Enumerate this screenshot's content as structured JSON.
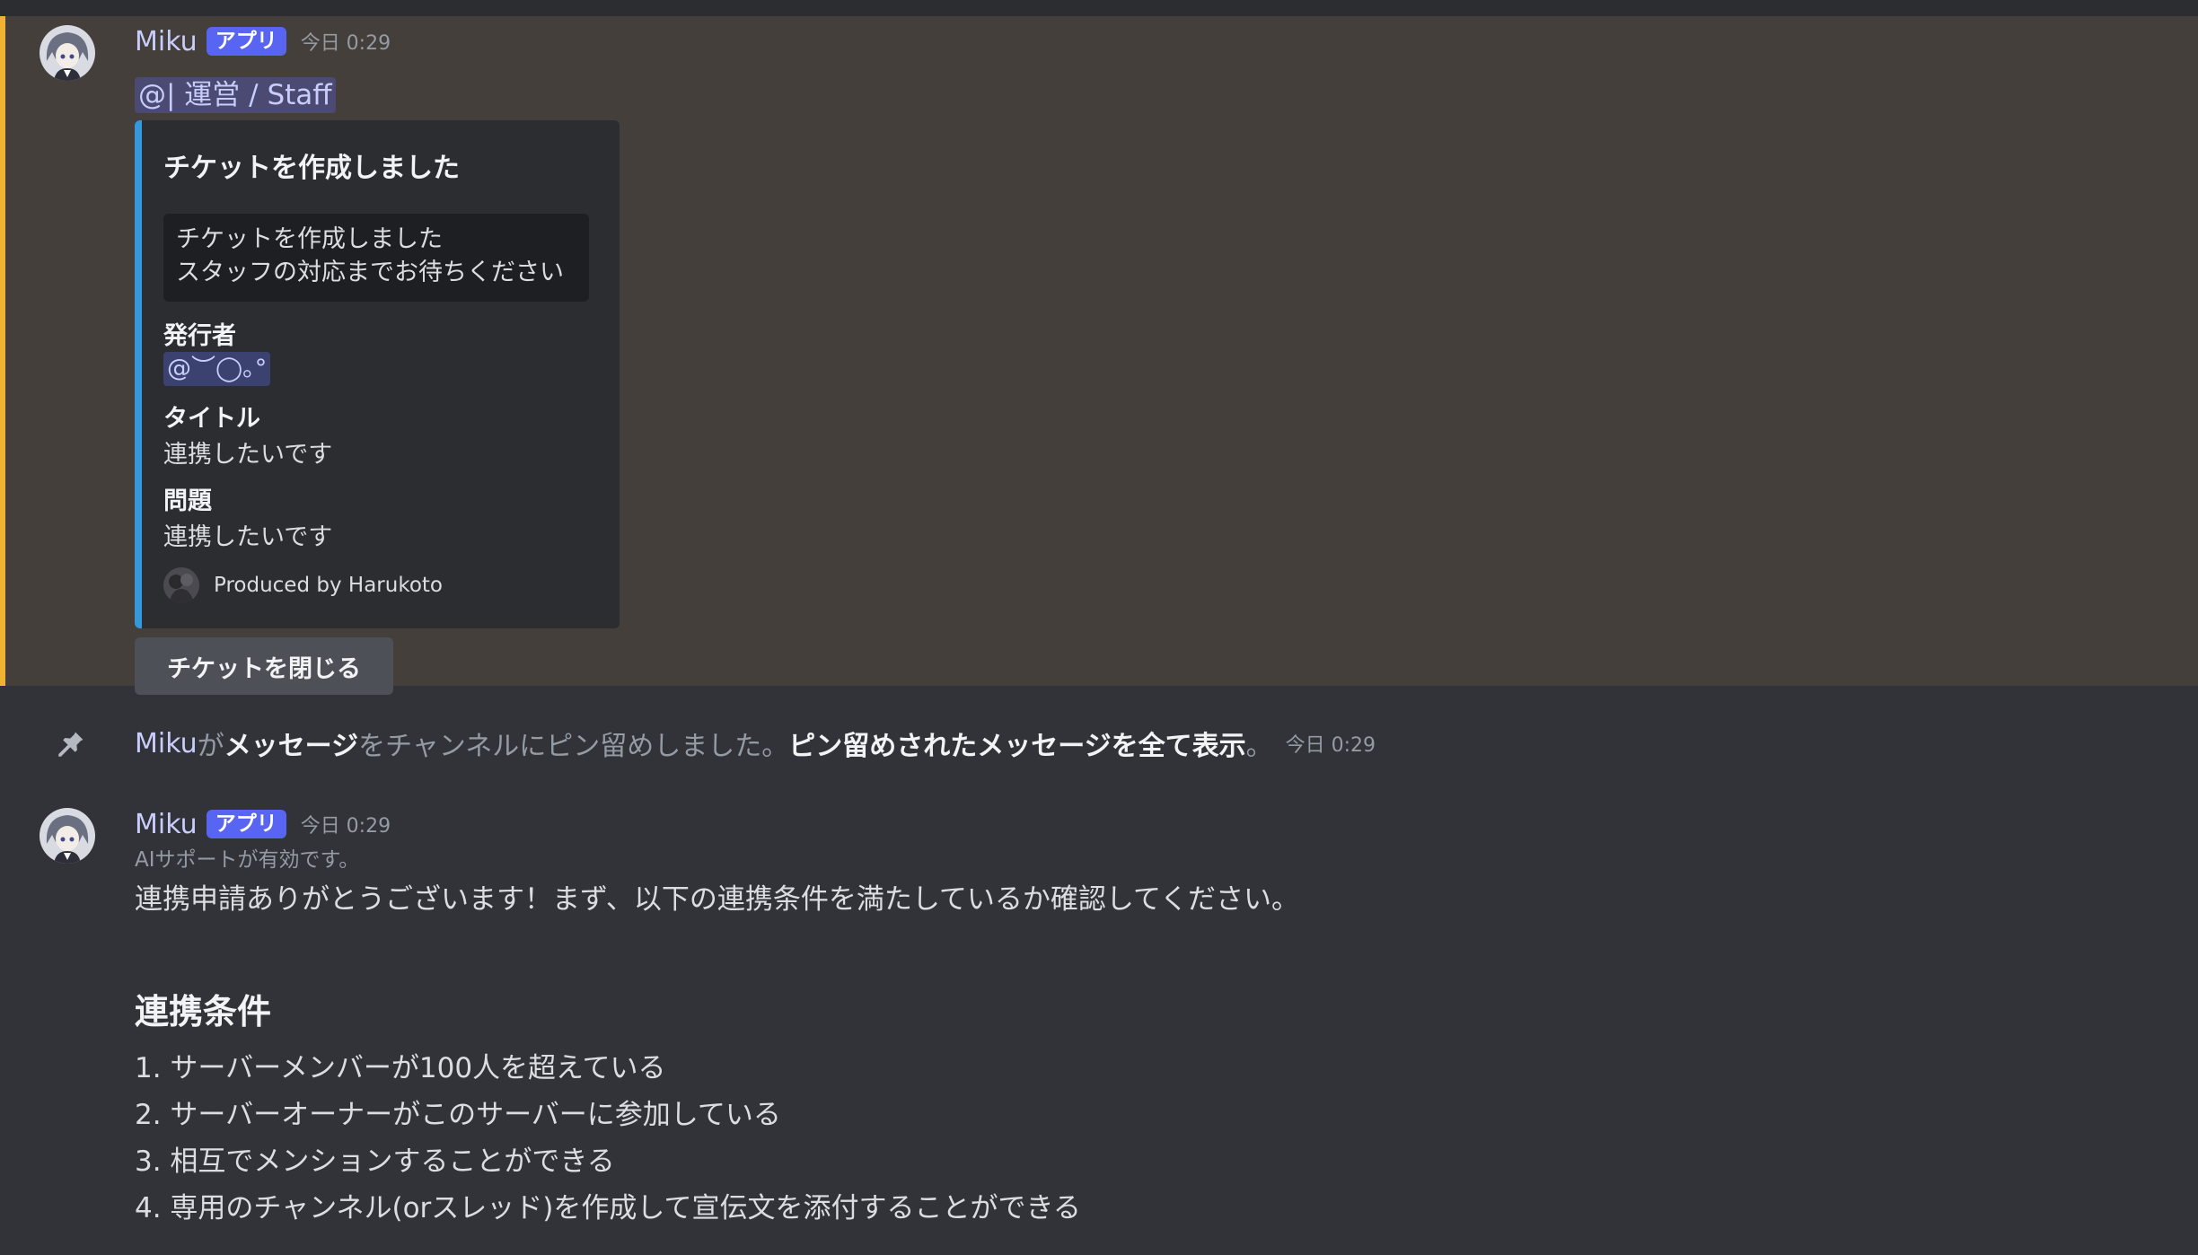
{
  "message1": {
    "username": "Miku",
    "badge": "アプリ",
    "timestamp": "今日 0:29",
    "role_mention": "@| 運営 / Staff",
    "embed": {
      "title": "チケットを作成しました",
      "code_lines": [
        "チケットを作成しました",
        "スタッフの対応までお待ちください"
      ],
      "fields": [
        {
          "name": "発行者",
          "value": "@︶◯｡°"
        },
        {
          "name": "タイトル",
          "value": "連携したいです"
        },
        {
          "name": "問題",
          "value": "連携したいです"
        }
      ],
      "footer": "Produced by Harukoto"
    },
    "button_label": "チケットを閉じる"
  },
  "pin_message": {
    "user": "Miku",
    "part1": " が",
    "link1": "メッセージ",
    "part2": "をチャンネルにピン留めしました。",
    "link2": "ピン留めされたメッセージを全て表示",
    "part3": "。",
    "timestamp": "今日 0:29"
  },
  "message2": {
    "username": "Miku",
    "badge": "アプリ",
    "timestamp": "今日 0:29",
    "ai_note": "AIサポートが有効です。",
    "intro": "連携申請ありがとうございます！まず、以下の連携条件を満たしているか確認してください。",
    "heading": "連携条件",
    "conditions": [
      "1. サーバーメンバーが100人を超えている",
      "2. サーバーオーナーがこのサーバーに参加している",
      "3. 相互でメンションすることができる",
      "4. 専用のチャンネル(orスレッド)を作成して宣伝文を添付することができる"
    ]
  },
  "colors": {
    "background": "#323339",
    "highlight_bg": "#443f3b",
    "highlight_bar": "#f0b232",
    "embed_accent": "#3498db",
    "badge": "#5865f2"
  },
  "icons": [
    "avatar",
    "pin-icon",
    "footer-avatar-icon"
  ]
}
